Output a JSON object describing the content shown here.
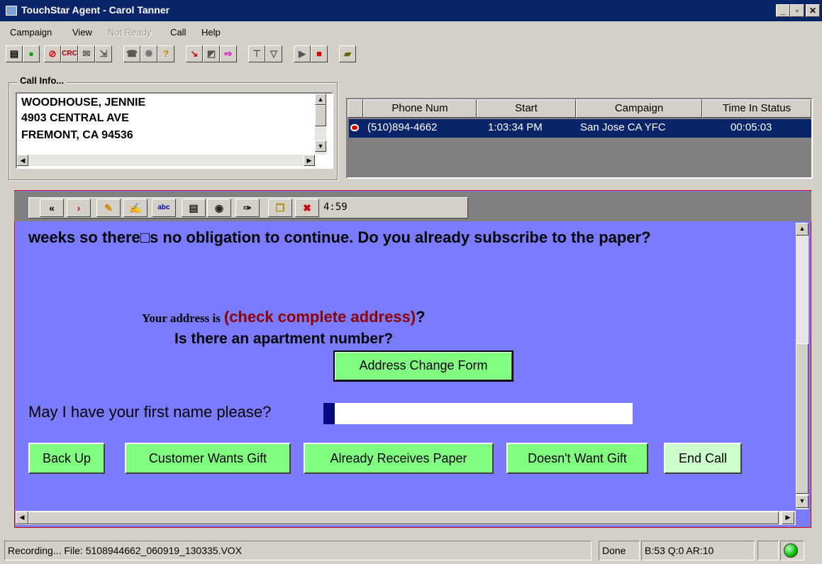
{
  "window": {
    "title": "TouchStar Agent - Carol Tanner",
    "min": "_",
    "max": "▫",
    "close": "✕"
  },
  "menu": {
    "campaign": "Campaign",
    "view": "View",
    "not_ready": "Not Ready",
    "call": "Call",
    "help": "Help"
  },
  "toolbar": {
    "crc_label": "CRC"
  },
  "call_info": {
    "label": "Call Info...",
    "name": "WOODHOUSE, JENNIE",
    "street": "4903  CENTRAL AVE",
    "city": "FREMONT,  CA 94536"
  },
  "calls_table": {
    "headers": [
      "Phone Num",
      "Start",
      "Campaign",
      "Time In Status"
    ],
    "rows": [
      {
        "phone": "(510)894-4662",
        "start": "1:03:34 PM",
        "campaign": "San Jose CA YFC",
        "time_in_status": "00:05:03"
      }
    ]
  },
  "script_toolbar": {
    "back": "«",
    "forward": "›",
    "timer": "4:59",
    "spell": "abc"
  },
  "script": {
    "intro": "weeks so there□s no obligation to continue.  Do you already subscribe to the paper?",
    "address_prefix": "Your address is",
    "address_check": "(check complete address)",
    "address_q": "?",
    "apartment_q": "Is there an apartment number?",
    "address_change_btn": "Address Change Form",
    "first_name_q": "May I have your first name please?",
    "first_name_value": ""
  },
  "actions": {
    "back_up": "Back Up",
    "wants_gift": "Customer Wants Gift",
    "already_receives": "Already Receives Paper",
    "doesnt_want": "Doesn't Want Gift",
    "end_call": "End Call"
  },
  "status": {
    "recording": "Recording... File: 5108944662_060919_130335.VOX",
    "done": "Done",
    "stats": "B:53 Q:0 AR:10"
  },
  "colors": {
    "script_bg": "#7b7bff",
    "action_green": "#80ff80",
    "title_blue": "#0a246a",
    "address_check_red": "#8b0000"
  }
}
